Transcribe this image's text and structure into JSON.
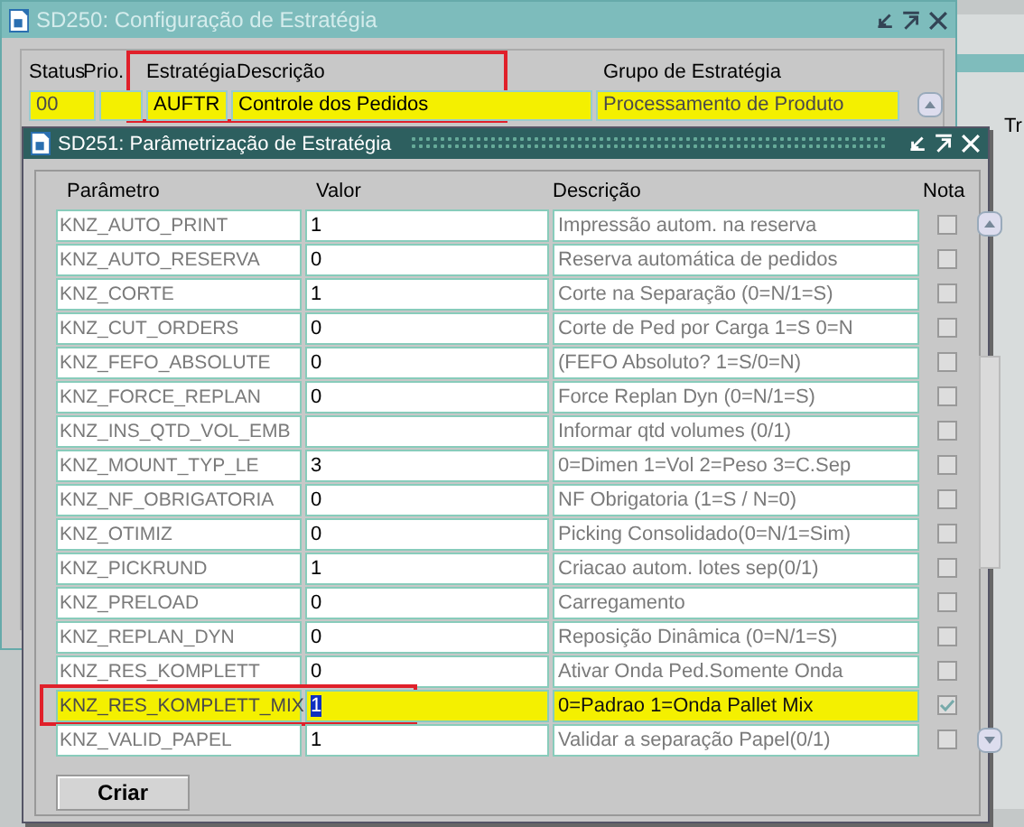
{
  "back_window": {
    "title": "SD250: Configuração de Estratégia",
    "columns": [
      {
        "label": "Status"
      },
      {
        "label": "Prio."
      },
      {
        "label": "Estratégia"
      },
      {
        "label": "Descrição"
      },
      {
        "label": "Grupo de Estratégia"
      }
    ],
    "row": {
      "status": "00",
      "estrategia": "AUFTR",
      "descricao": "Controle dos Pedidos",
      "grupo": "Processamento de Produto",
      "selected": true,
      "marked": true
    },
    "edge_text": "Tr"
  },
  "front_window": {
    "title": "SD251: Parâmetrização de Estratégia",
    "columns": [
      {
        "label": "Parâmetro"
      },
      {
        "label": "Valor"
      },
      {
        "label": "Descrição"
      },
      {
        "label": "Nota"
      }
    ],
    "rows": [
      {
        "parametro": "KNZ_AUTO_PRINT",
        "valor": "1",
        "descricao": "Impressão autom. na reserva",
        "nota": false,
        "selected": false,
        "marked": false
      },
      {
        "parametro": "KNZ_AUTO_RESERVA",
        "valor": "0",
        "descricao": "Reserva automática de pedidos",
        "nota": false,
        "selected": false,
        "marked": false
      },
      {
        "parametro": "KNZ_CORTE",
        "valor": "1",
        "descricao": "Corte na Separação (0=N/1=S)",
        "nota": false,
        "selected": false,
        "marked": false
      },
      {
        "parametro": "KNZ_CUT_ORDERS",
        "valor": "0",
        "descricao": "Corte de Ped por Carga 1=S 0=N",
        "nota": false,
        "selected": false,
        "marked": false
      },
      {
        "parametro": "KNZ_FEFO_ABSOLUTE",
        "valor": "0",
        "descricao": "(FEFO Absoluto? 1=S/0=N)",
        "nota": false,
        "selected": false,
        "marked": false
      },
      {
        "parametro": "KNZ_FORCE_REPLAN",
        "valor": "0",
        "descricao": "Force Replan Dyn (0=N/1=S)",
        "nota": false,
        "selected": false,
        "marked": false
      },
      {
        "parametro": "KNZ_INS_QTD_VOL_EMB",
        "descricao": "Informar qtd volumes (0/1)",
        "nota": false,
        "selected": false,
        "marked": false
      },
      {
        "parametro": "KNZ_MOUNT_TYP_LE",
        "valor": "3",
        "descricao": "0=Dimen 1=Vol 2=Peso 3=C.Sep",
        "nota": false,
        "selected": false,
        "marked": false
      },
      {
        "parametro": "KNZ_NF_OBRIGATORIA",
        "valor": "0",
        "descricao": "NF Obrigatoria (1=S / N=0)",
        "nota": false,
        "selected": false,
        "marked": false
      },
      {
        "parametro": "KNZ_OTIMIZ",
        "valor": "0",
        "descricao": "Picking Consolidado(0=N/1=Sim)",
        "nota": false,
        "selected": false,
        "marked": false
      },
      {
        "parametro": "KNZ_PICKRUND",
        "valor": "1",
        "descricao": "Criacao autom. lotes sep(0/1)",
        "nota": false,
        "selected": false,
        "marked": false
      },
      {
        "parametro": "KNZ_PRELOAD",
        "valor": "0",
        "descricao": "Carregamento",
        "nota": false,
        "selected": false,
        "marked": false
      },
      {
        "parametro": "KNZ_REPLAN_DYN",
        "valor": "0",
        "descricao": "Reposição Dinâmica (0=N/1=S)",
        "nota": false,
        "selected": false,
        "marked": false
      },
      {
        "parametro": "KNZ_RES_KOMPLETT",
        "valor": "0",
        "descricao": "Ativar Onda Ped.Somente Onda",
        "nota": false,
        "selected": false,
        "marked": false
      },
      {
        "parametro": "KNZ_RES_KOMPLETT_MIX",
        "valor": "1",
        "descricao": "0=Padrao 1=Onda Pallet Mix",
        "nota": true,
        "selected": true,
        "marked": true
      },
      {
        "parametro": "KNZ_VALID_PAPEL",
        "valor": "1",
        "descricao": "Validar a separação Papel(0/1)",
        "nota": false,
        "selected": false,
        "marked": false
      }
    ],
    "button": "Criar"
  }
}
